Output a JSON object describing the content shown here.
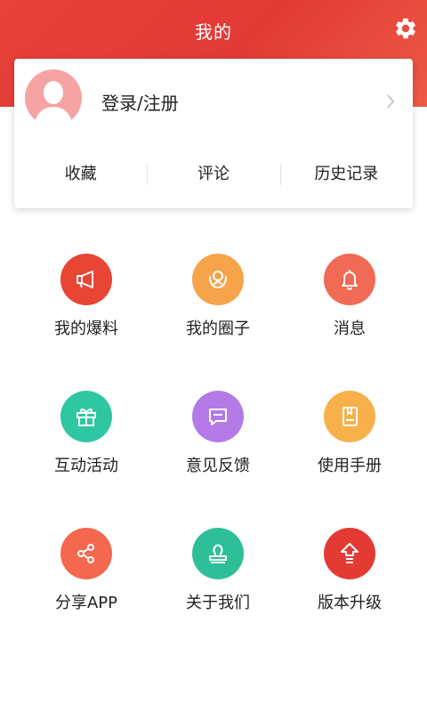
{
  "header": {
    "title": "我的"
  },
  "profile": {
    "login_label": "登录/注册"
  },
  "quick_tabs": [
    {
      "label": "收藏"
    },
    {
      "label": "评论"
    },
    {
      "label": "历史记录"
    }
  ],
  "grid_items": [
    {
      "label": "我的爆料",
      "icon": "megaphone-icon",
      "color": "#e84535"
    },
    {
      "label": "我的圈子",
      "icon": "circle-hands-icon",
      "color": "#f6a34a"
    },
    {
      "label": "消息",
      "icon": "bell-icon",
      "color": "#f06a55"
    },
    {
      "label": "互动活动",
      "icon": "gift-icon",
      "color": "#2fc7a1"
    },
    {
      "label": "意见反馈",
      "icon": "chat-bubble-icon",
      "color": "#b47ae8"
    },
    {
      "label": "使用手册",
      "icon": "manual-icon",
      "color": "#f7b04a"
    },
    {
      "label": "分享APP",
      "icon": "share-icon",
      "color": "#f4684f"
    },
    {
      "label": "关于我们",
      "icon": "stamp-icon",
      "color": "#2ebf98"
    },
    {
      "label": "版本升级",
      "icon": "upgrade-icon",
      "color": "#e43a34"
    }
  ]
}
